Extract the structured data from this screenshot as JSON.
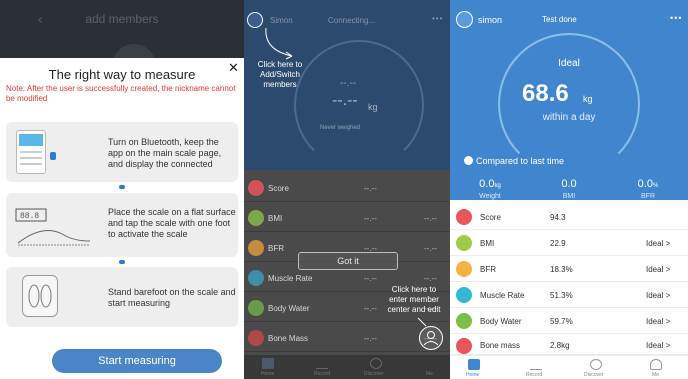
{
  "panel1": {
    "topbar": {
      "back_icon": "chevron-left-icon",
      "title": "add members"
    },
    "dialog": {
      "title": "The right way to measure",
      "close_icon": "close-icon",
      "note": "Note: After the user is successfully created, the nickname cannot be modified",
      "steps": [
        {
          "text": "Turn on Bluetooth, keep the app on the main scale page, and display the connected",
          "image": "phone-bluetooth-illustration"
        },
        {
          "text": "Place the scale on a flat surface and tap the scale with one foot to activate the scale",
          "image": "scale-foot-tap-illustration",
          "scale_readout": "88.8"
        },
        {
          "text": "Stand barefoot on the scale and start measuring",
          "image": "barefoot-scale-illustration"
        }
      ],
      "start_button": "Start measuring"
    },
    "colors": {
      "accent": "#4a86c7",
      "note": "#e23a2f"
    }
  },
  "panel2": {
    "header": {
      "user": "Simon",
      "status": "Connecting...",
      "more_icon": "more-dots-icon"
    },
    "hint_avatar": "Click here to Add/Switch members",
    "weight": {
      "top": "--.--",
      "main": "--.--",
      "unit": "kg",
      "sub": "Never weighed"
    },
    "rows": [
      {
        "name": "Score",
        "value": "--.--",
        "right": "",
        "color": "#d2545a"
      },
      {
        "name": "BMI",
        "value": "--.--",
        "right": "--.--",
        "color": "#7fa84b"
      },
      {
        "name": "BFR",
        "value": "--.--",
        "right": "--.--",
        "color": "#c58e3d"
      },
      {
        "name": "Muscle Rate",
        "value": "--.--",
        "right": "--.--",
        "color": "#3c8fa6"
      },
      {
        "name": "Body Water",
        "value": "--.--",
        "right": "--.--",
        "color": "#6c9a46"
      },
      {
        "name": "Bone Mass",
        "value": "--.--",
        "right": "--.--",
        "color": "#b0474d"
      }
    ],
    "got_it": "Got it",
    "hint_me": "Click here to enter member center and edit",
    "tabs": [
      "Home",
      "Record",
      "Discover",
      "Me"
    ]
  },
  "panel3": {
    "header": {
      "user": "simon",
      "status": "Test done",
      "more_icon": "more-dots-icon"
    },
    "weight": {
      "label": "Ideal",
      "value": "68.6",
      "unit": "kg",
      "sub": "within a day"
    },
    "compare_label": "Compared to last time",
    "stats": [
      {
        "value": "0.0",
        "unit": "kg",
        "label": "Weight"
      },
      {
        "value": "0.0",
        "unit": "",
        "label": "BMI"
      },
      {
        "value": "0.0",
        "unit": "%",
        "label": "BFR"
      }
    ],
    "rows": [
      {
        "name": "Score",
        "value": "94.3",
        "status": "",
        "color": "#e8555b"
      },
      {
        "name": "BMI",
        "value": "22.9",
        "status": "Ideal  >",
        "color": "#9ccc4a"
      },
      {
        "name": "BFR",
        "value": "18.3%",
        "status": "Ideal  >",
        "color": "#f4b245"
      },
      {
        "name": "Muscle Rate",
        "value": "51.3%",
        "status": "Ideal  >",
        "color": "#35b6d4"
      },
      {
        "name": "Body Water",
        "value": "59.7%",
        "status": "Ideal  >",
        "color": "#7dbd4a"
      },
      {
        "name": "Bone mass",
        "value": "2.8kg",
        "status": "Ideal  >",
        "color": "#e8555b"
      }
    ],
    "tabs": [
      "Home",
      "Record",
      "Discover",
      "Me"
    ],
    "colors": {
      "hero": "#3f86cf"
    }
  }
}
